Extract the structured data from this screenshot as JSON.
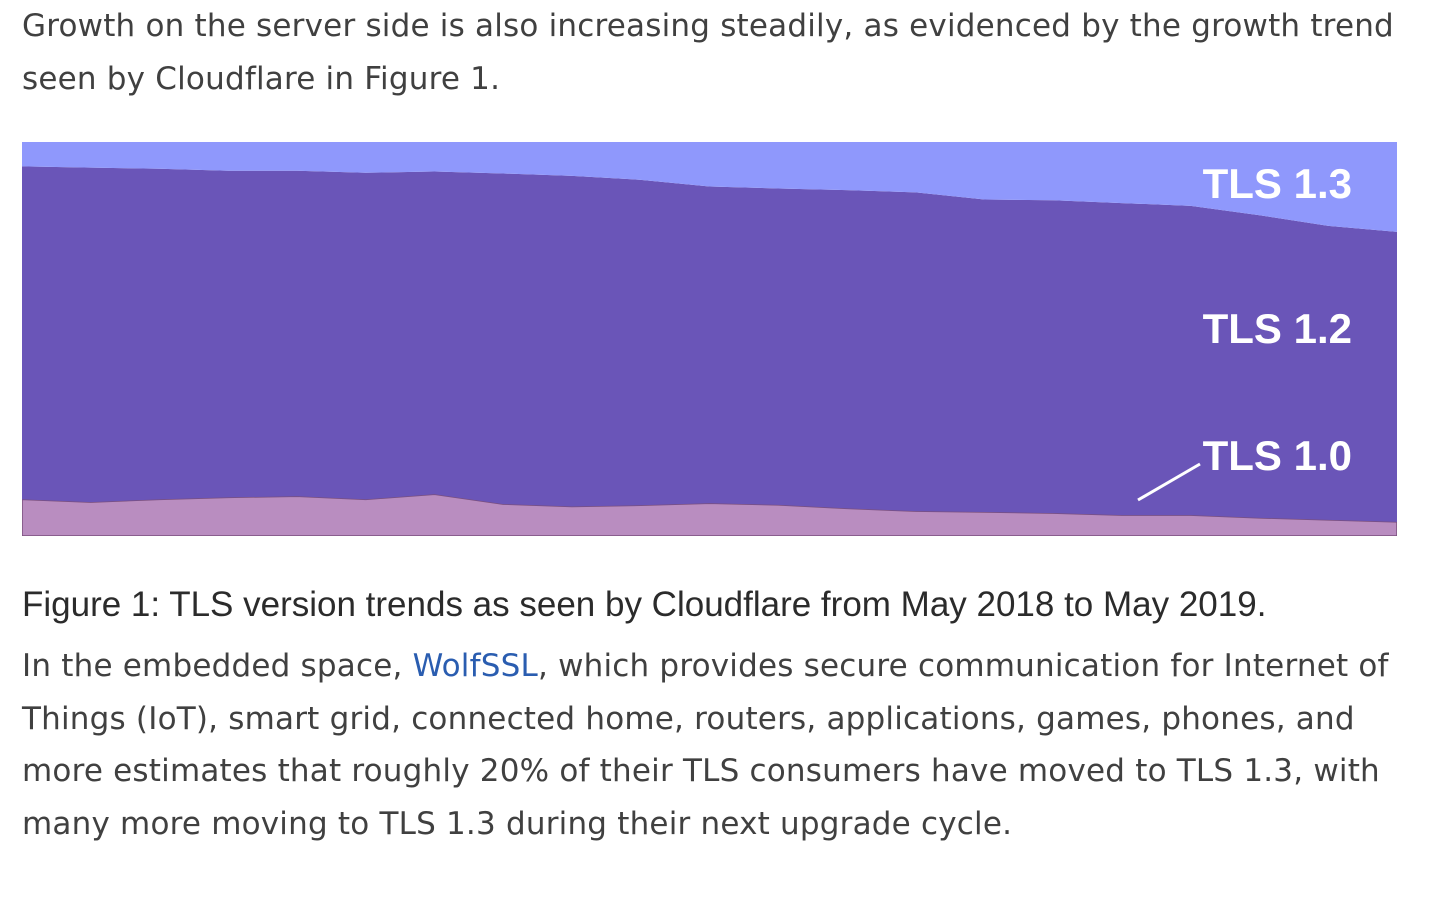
{
  "article": {
    "intro_paragraph": "Growth on the server side is also increasing steadily, as evidenced by the growth trend seen by Cloudflare in Figure 1.",
    "figure_caption": "Figure 1: TLS version trends as seen by Cloudflare from May 2018 to May 2019.",
    "body_before_link": "In the embedded space, ",
    "link_text": "WolfSSL",
    "body_after_link": ", which provides secure communication for Internet of Things (IoT), smart grid, connected home, routers, applications, games, phones, and more estimates that roughly 20% of their TLS consumers have moved to TLS 1.3, with many more moving to TLS 1.3 during their next upgrade cycle."
  },
  "chart_data": {
    "type": "area",
    "stacked": true,
    "normalized": true,
    "x_range": [
      "May 2018",
      "May 2019"
    ],
    "ylim": [
      0,
      100
    ],
    "x": [
      0,
      5,
      10,
      15,
      20,
      25,
      30,
      35,
      40,
      45,
      50,
      55,
      60,
      65,
      70,
      75,
      80,
      85,
      90,
      95,
      100
    ],
    "series": [
      {
        "name": "TLS 1.0",
        "color": "#b98dc0",
        "values": [
          9.3,
          8.6,
          9.3,
          9.8,
          10.1,
          9.3,
          10.6,
          8.1,
          7.5,
          7.8,
          8.3,
          7.9,
          7.0,
          6.3,
          6.1,
          5.8,
          5.3,
          5.3,
          4.6,
          4.1,
          3.6
        ]
      },
      {
        "name": "TLS 1.2",
        "color": "#6a55b8",
        "values": [
          84.5,
          84.9,
          83.9,
          82.9,
          82.6,
          82.9,
          81.9,
          83.9,
          83.9,
          82.6,
          80.4,
          80.3,
          80.8,
          80.9,
          79.3,
          79.4,
          79.2,
          78.5,
          76.8,
          74.6,
          73.6
        ]
      },
      {
        "name": "TLS 1.3",
        "color": "#8f98fc",
        "values": [
          6.2,
          6.5,
          6.8,
          7.3,
          7.3,
          7.8,
          7.5,
          8.0,
          8.6,
          9.6,
          11.3,
          11.8,
          12.2,
          12.8,
          14.6,
          14.8,
          15.5,
          16.2,
          18.6,
          21.3,
          22.8
        ]
      }
    ],
    "annotations": [
      {
        "label": "TLS 1.3",
        "series": "TLS 1.3",
        "position": "top-right"
      },
      {
        "label": "TLS 1.2",
        "series": "TLS 1.2",
        "position": "center-right"
      },
      {
        "label": "TLS 1.0",
        "series": "TLS 1.0",
        "position": "bottom-right",
        "leader_line": true
      }
    ]
  }
}
